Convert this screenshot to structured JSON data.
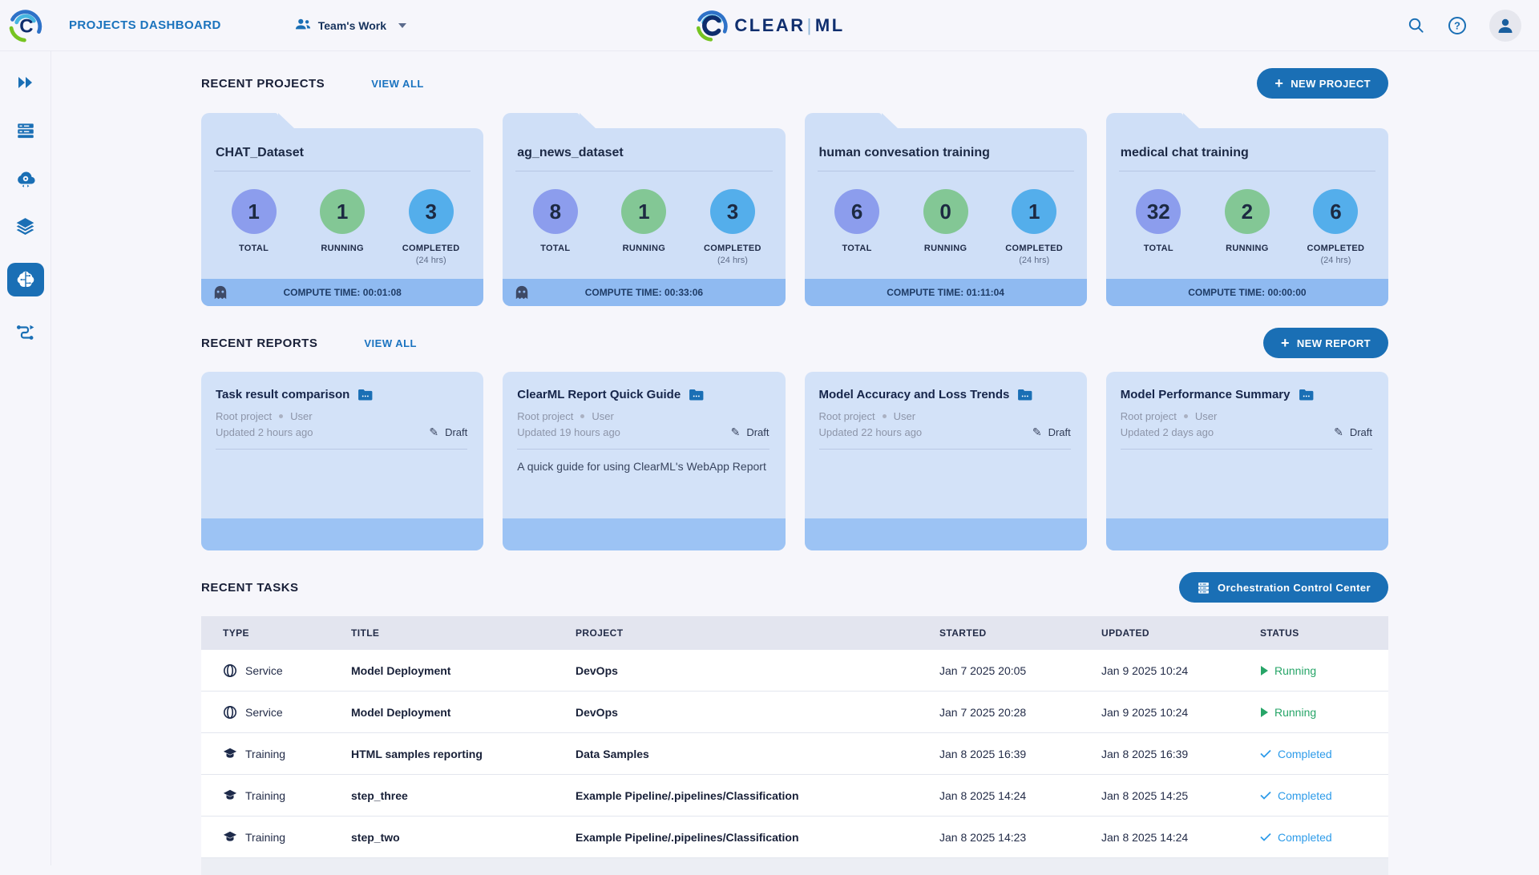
{
  "header": {
    "title": "PROJECTS DASHBOARD",
    "workspace": "Team's Work",
    "logo_clear": "CLEAR",
    "logo_ml": "ML",
    "logo_sep": "|"
  },
  "colors": {
    "accent_blue": "#1a6fb5",
    "link_blue": "#1a73c0",
    "running_green": "#27a568",
    "completed_blue": "#2d9be9",
    "total_circle": "#8c9ded",
    "running_circle": "#83c795",
    "completed_circle": "#54aeeb",
    "card_body": "#cfdff7",
    "card_footer": "#8fbaf1"
  },
  "recent_projects": {
    "title": "RECENT PROJECTS",
    "view_all": "VIEW ALL",
    "new_button": "NEW PROJECT",
    "stat_labels": {
      "total": "TOTAL",
      "running": "RUNNING",
      "completed": "COMPLETED",
      "completed_sub": "(24 hrs)"
    },
    "cards": [
      {
        "name": "CHAT_Dataset",
        "total": "1",
        "running": "1",
        "completed": "3",
        "compute": "COMPUTE TIME: 00:01:08"
      },
      {
        "name": "ag_news_dataset",
        "total": "8",
        "running": "1",
        "completed": "3",
        "compute": "COMPUTE TIME: 00:33:06"
      },
      {
        "name": "human convesation training",
        "total": "6",
        "running": "0",
        "completed": "1",
        "compute": "COMPUTE TIME: 01:11:04"
      },
      {
        "name": "medical chat training",
        "total": "32",
        "running": "2",
        "completed": "6",
        "compute": "COMPUTE TIME: 00:00:00"
      }
    ]
  },
  "recent_reports": {
    "title": "RECENT REPORTS",
    "view_all": "VIEW ALL",
    "new_button": "NEW REPORT",
    "cards": [
      {
        "title": "Task result comparison",
        "project": "Root project",
        "author": "User",
        "updated": "Updated 2 hours ago",
        "status": "Draft",
        "description": ""
      },
      {
        "title": "ClearML Report Quick Guide",
        "project": "Root project",
        "author": "User",
        "updated": "Updated 19 hours ago",
        "status": "Draft",
        "description": "A quick guide for using ClearML's WebApp Report"
      },
      {
        "title": "Model Accuracy and Loss Trends",
        "project": "Root project",
        "author": "User",
        "updated": "Updated 22 hours ago",
        "status": "Draft",
        "description": ""
      },
      {
        "title": "Model Performance Summary",
        "project": "Root project",
        "author": "User",
        "updated": "Updated 2 days ago",
        "status": "Draft",
        "description": ""
      }
    ]
  },
  "recent_tasks": {
    "title": "RECENT TASKS",
    "orchestration_button": "Orchestration Control Center",
    "columns": [
      "TYPE",
      "TITLE",
      "PROJECT",
      "STARTED",
      "UPDATED",
      "STATUS"
    ],
    "rows": [
      {
        "type": "Service",
        "title": "Model Deployment",
        "project": "DevOps",
        "started": "Jan 7 2025 20:05",
        "updated": "Jan 9 2025 10:24",
        "status": "Running"
      },
      {
        "type": "Service",
        "title": "Model Deployment",
        "project": "DevOps",
        "started": "Jan 7 2025 20:28",
        "updated": "Jan 9 2025 10:24",
        "status": "Running"
      },
      {
        "type": "Training",
        "title": "HTML samples reporting",
        "project": "Data Samples",
        "started": "Jan 8 2025 16:39",
        "updated": "Jan 8 2025 16:39",
        "status": "Completed"
      },
      {
        "type": "Training",
        "title": "step_three",
        "project": "Example Pipeline/.pipelines/Classification",
        "started": "Jan 8 2025 14:24",
        "updated": "Jan 8 2025 14:25",
        "status": "Completed"
      },
      {
        "type": "Training",
        "title": "step_two",
        "project": "Example Pipeline/.pipelines/Classification",
        "started": "Jan 8 2025 14:23",
        "updated": "Jan 8 2025 14:24",
        "status": "Completed"
      }
    ]
  }
}
